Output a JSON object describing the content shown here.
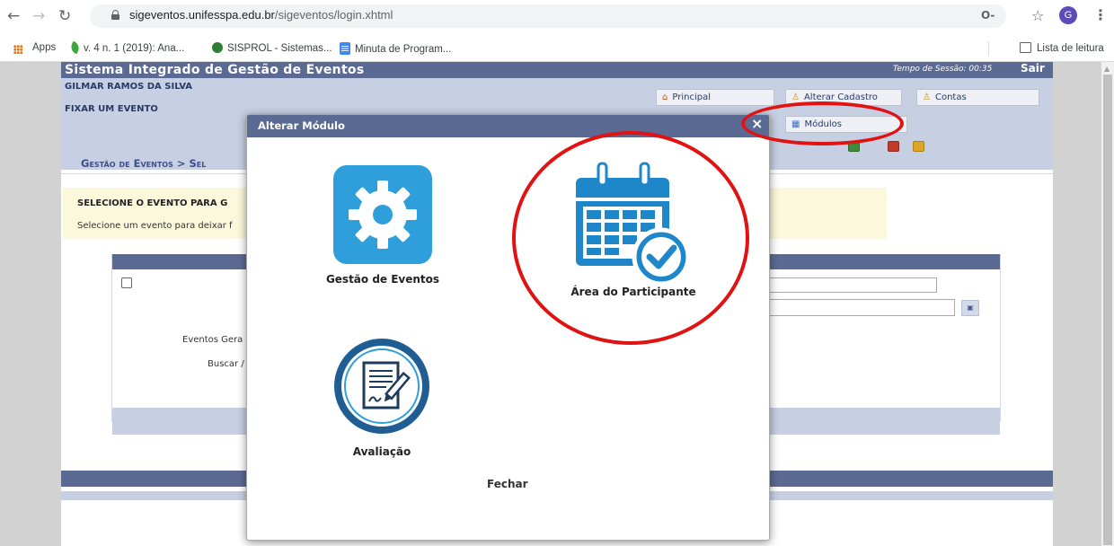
{
  "browser": {
    "url_domain": "sigeventos.unifesspa.edu.br",
    "url_path": "/sigeventos/login.xhtml",
    "profile_initial": "G",
    "bookmarks": [
      {
        "label": "Apps"
      },
      {
        "label": "v. 4 n. 1 (2019): Ana..."
      },
      {
        "label": "SISPROL - Sistemas..."
      },
      {
        "label": "Minuta de Program..."
      }
    ],
    "reading_list": "Lista de leitura"
  },
  "app": {
    "title": "Sistema Integrado de Gestão de Eventos",
    "session_label": "Tempo de Sessão: 00:35",
    "logout_label": "Sair",
    "user_name": "GILMAR RAMOS DA SILVA",
    "fix_event_label": "FIXAR UM EVENTO",
    "menu": {
      "principal": "Principal",
      "alterar_cadastro": "Alterar Cadastro",
      "contas": "Contas",
      "modulos": "Módulos"
    },
    "breadcrumb": "Gestão de Eventos > Sel",
    "info_title": "SELECIONE O EVENTO PARA G",
    "info_text": "Selecione um evento para deixar f",
    "form": {
      "eventos_label": "Eventos Gera",
      "buscar_label": "Buscar /"
    }
  },
  "modal": {
    "title": "Alterar Módulo",
    "close_glyph": "×",
    "modules": [
      {
        "label": "Gestão de Eventos",
        "icon": "gear-icon"
      },
      {
        "label": "Área do Participante",
        "icon": "calendar-check-icon"
      },
      {
        "label": "Avaliação",
        "icon": "document-signature-icon"
      }
    ],
    "close_label": "Fechar"
  },
  "colors": {
    "header_blue": "#5b6a93",
    "light_blue": "#c7cfe3",
    "gear_tile": "#2f9fdb",
    "calendar_blue": "#1e87c9",
    "annotation_red": "#e01212"
  }
}
